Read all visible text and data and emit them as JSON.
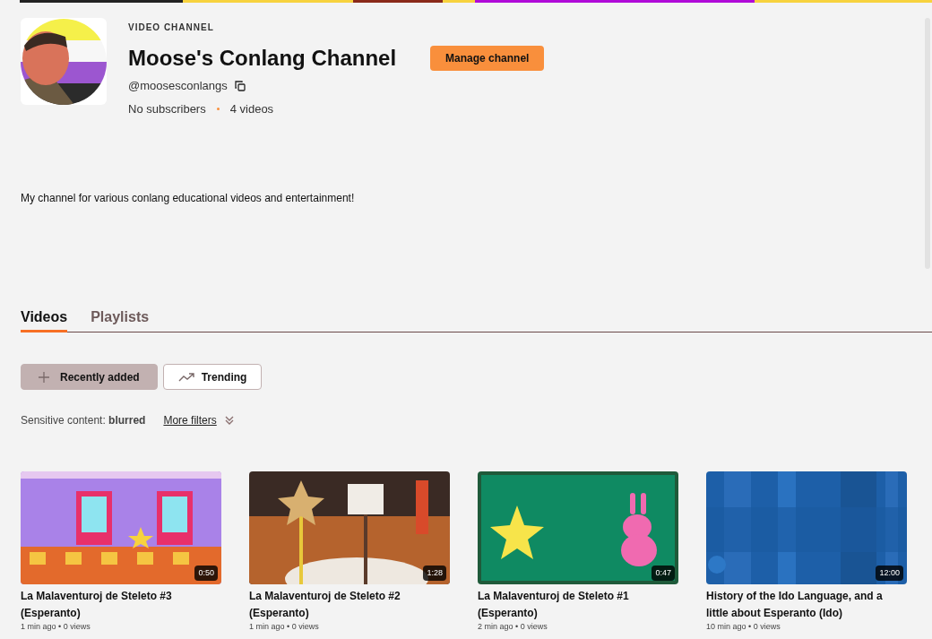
{
  "channel": {
    "kind_label": "VIDEO CHANNEL",
    "name": "Moose's Conlang Channel",
    "handle": "@moosesconlangs",
    "subscribers": "No subscribers",
    "video_count": "4 videos",
    "manage_button": "Manage channel",
    "description": "My channel for various conlang educational videos and entertainment!"
  },
  "tabs": [
    {
      "label": "Videos",
      "selected": true
    },
    {
      "label": "Playlists",
      "selected": false
    }
  ],
  "sort_buttons": [
    {
      "label": "Recently added",
      "selected": true
    },
    {
      "label": "Trending",
      "selected": false
    }
  ],
  "filters": {
    "label": "Sensitive content: **blurred**",
    "more": "More filters"
  },
  "videos": [
    {
      "title": "La Malaventuroj de Steleto #3 (Esperanto)",
      "duration": "0:50",
      "meta": "1 min ago • 0 views",
      "kind": "picture"
    },
    {
      "title": "La Malaventuroj de Steleto #2 (Esperanto)",
      "duration": "1:28",
      "meta": "1 min ago • 0 views",
      "kind": "picture"
    },
    {
      "title": "La Malaventuroj de Steleto #1 (Esperanto)",
      "duration": "0:47",
      "meta": "2 min ago • 0 views",
      "kind": "picture"
    },
    {
      "title": "History of the Ido Language, and a little about Esperanto (Ido)",
      "duration": "12:00",
      "meta": "10 min ago • 0 views",
      "kind": "picture"
    }
  ]
}
